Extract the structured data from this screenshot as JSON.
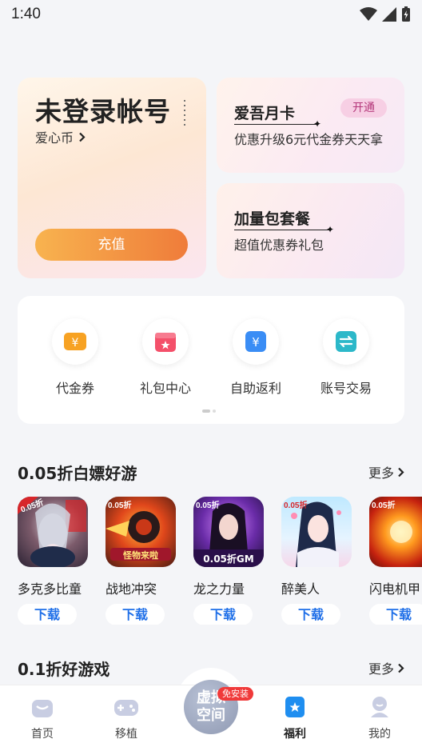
{
  "status_bar": {
    "time": "1:40"
  },
  "account": {
    "title": "未登录帐号",
    "coin_link": "爱心币",
    "recharge_label": "充值"
  },
  "monthly_card": {
    "title": "爱吾月卡",
    "subtitle": "优惠升级6元代金券天天拿",
    "open_label": "开通"
  },
  "package_card": {
    "title": "加量包套餐",
    "subtitle": "超值优惠券礼包"
  },
  "tools": [
    {
      "label": "代金券",
      "icon": "voucher-icon",
      "color": "#f7a223"
    },
    {
      "label": "礼包中心",
      "icon": "gift-icon",
      "color": "#f4506a"
    },
    {
      "label": "自助返利",
      "icon": "rebate-icon",
      "color": "#3a8df5"
    },
    {
      "label": "账号交易",
      "icon": "trade-icon",
      "color": "#2cb8c9"
    }
  ],
  "section1": {
    "title": "0.05折白嫖好游",
    "more": "更多",
    "games": [
      {
        "name": "多克多比童",
        "download": "下载"
      },
      {
        "name": "战地冲突",
        "download": "下载"
      },
      {
        "name": "龙之力量",
        "download": "下载"
      },
      {
        "name": "醉美人",
        "download": "下载"
      },
      {
        "name": "闪电机甲",
        "download": "下载"
      }
    ]
  },
  "section2": {
    "title": "0.1折好游戏",
    "more": "更多"
  },
  "tab_bar": {
    "tabs": [
      {
        "label": "首页"
      },
      {
        "label": "移植"
      },
      {
        "label": "福利",
        "active": true
      },
      {
        "label": "我的"
      }
    ],
    "center_label": "虚拟空间",
    "center_badge": "免安装"
  },
  "colors": {
    "accent_blue": "#1f6fe8",
    "recharge_gradient_start": "#f8b34f",
    "recharge_gradient_end": "#ef7c3a",
    "badge_red": "#f03a3a"
  }
}
